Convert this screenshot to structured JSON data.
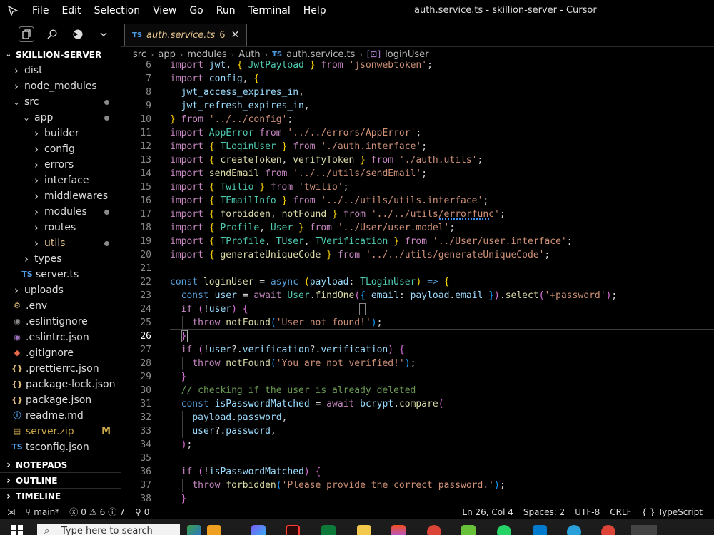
{
  "titlebar": {
    "menu": [
      "File",
      "Edit",
      "Selection",
      "View",
      "Go",
      "Run",
      "Terminal",
      "Help"
    ],
    "window_title": "auth.service.ts - skillion-server - Cursor"
  },
  "sidebar": {
    "root": "SKILLION-SERVER",
    "tree": [
      {
        "label": "dist",
        "type": "folder",
        "depth": 1,
        "open": false
      },
      {
        "label": "node_modules",
        "type": "folder",
        "depth": 1,
        "open": false
      },
      {
        "label": "src",
        "type": "folder",
        "depth": 1,
        "open": true,
        "dot": true
      },
      {
        "label": "app",
        "type": "folder",
        "depth": 2,
        "open": true,
        "dot": true
      },
      {
        "label": "builder",
        "type": "folder",
        "depth": 3,
        "open": false
      },
      {
        "label": "config",
        "type": "folder",
        "depth": 3,
        "open": false
      },
      {
        "label": "errors",
        "type": "folder",
        "depth": 3,
        "open": false
      },
      {
        "label": "interface",
        "type": "folder",
        "depth": 3,
        "open": false
      },
      {
        "label": "middlewares",
        "type": "folder",
        "depth": 3,
        "open": false
      },
      {
        "label": "modules",
        "type": "folder",
        "depth": 3,
        "open": false,
        "dot": true
      },
      {
        "label": "routes",
        "type": "folder",
        "depth": 3,
        "open": false
      },
      {
        "label": "utils",
        "type": "folder",
        "depth": 3,
        "open": false,
        "dot": true,
        "color": "#e2c08d"
      },
      {
        "label": "types",
        "type": "folder",
        "depth": 2,
        "open": false
      },
      {
        "label": "server.ts",
        "type": "file",
        "depth": 2,
        "icon": "TS",
        "icon_color": "#4d9be5"
      },
      {
        "label": "uploads",
        "type": "folder",
        "depth": 1,
        "open": false
      },
      {
        "label": ".env",
        "type": "file",
        "depth": 1,
        "icon": "⚙",
        "icon_color": "#e5c07b"
      },
      {
        "label": ".eslintignore",
        "type": "file",
        "depth": 1,
        "icon": "◉",
        "icon_color": "#8a8a8a"
      },
      {
        "label": ".eslintrc.json",
        "type": "file",
        "depth": 1,
        "icon": "◉",
        "icon_color": "#a074c4"
      },
      {
        "label": ".gitignore",
        "type": "file",
        "depth": 1,
        "icon": "◆",
        "icon_color": "#e46a4a"
      },
      {
        "label": ".prettierrc.json",
        "type": "file",
        "depth": 1,
        "icon": "{}",
        "icon_color": "#e5c07b"
      },
      {
        "label": "package-lock.json",
        "type": "file",
        "depth": 1,
        "icon": "{}",
        "icon_color": "#e5c07b"
      },
      {
        "label": "package.json",
        "type": "file",
        "depth": 1,
        "icon": "{}",
        "icon_color": "#e5c07b"
      },
      {
        "label": "readme.md",
        "type": "file",
        "depth": 1,
        "icon": "ⓘ",
        "icon_color": "#4d9be5"
      },
      {
        "label": "server.zip",
        "type": "file",
        "depth": 1,
        "icon": "▤",
        "icon_color": "#c9a64a",
        "color": "#c9a64a",
        "mark": "M"
      },
      {
        "label": "tsconfig.json",
        "type": "file",
        "depth": 1,
        "icon": "TS",
        "icon_color": "#4d9be5"
      }
    ],
    "panels": [
      "NOTEPADS",
      "OUTLINE",
      "TIMELINE"
    ]
  },
  "tab": {
    "icon": "TS",
    "label": "auth.service.ts",
    "count": "6"
  },
  "breadcrumb": [
    "src",
    "app",
    "modules",
    "Auth",
    "auth.service.ts",
    "loginUser"
  ],
  "code": {
    "line_numbers": [
      "6",
      "7",
      "8",
      "9",
      "10",
      "11",
      "12",
      "13",
      "14",
      "15",
      "16",
      "17",
      "18",
      "19",
      "20",
      "21",
      "22",
      "23",
      "24",
      "25",
      "26",
      "27",
      "28",
      "29",
      "30",
      "31",
      "32",
      "33",
      "34",
      "35",
      "36",
      "37",
      "38"
    ],
    "current_line": "26"
  },
  "status": {
    "branch": "main*",
    "errors": "0",
    "warnings": "6",
    "info": "7",
    "ports": "0",
    "position": "Ln 26, Col 4",
    "spaces": "Spaces: 2",
    "encoding": "UTF-8",
    "eol": "CRLF",
    "language": "TypeScript",
    "language_icon": "{ }"
  },
  "taskbar": {
    "search_placeholder": "Type here to search"
  }
}
